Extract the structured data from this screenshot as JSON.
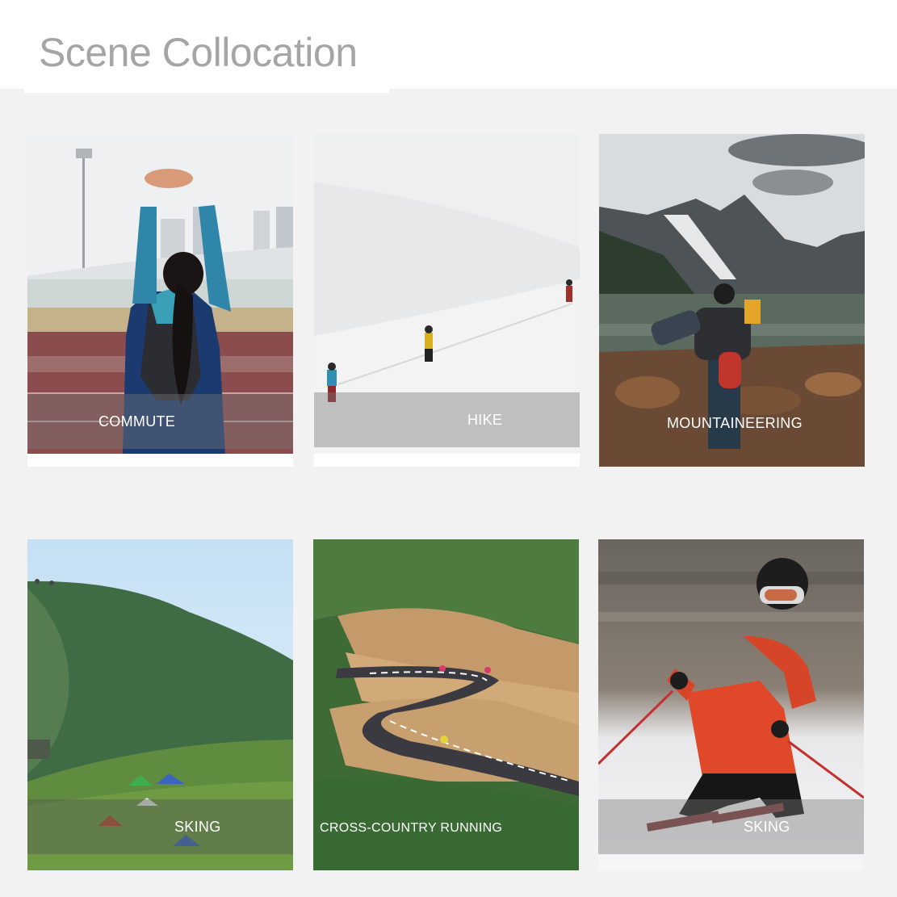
{
  "header": {
    "title": "Scene Collocation"
  },
  "cards": [
    {
      "label": "COMMUTE"
    },
    {
      "label": "HIKE"
    },
    {
      "label": "MOUNTAINEERING"
    },
    {
      "label": "SKING"
    },
    {
      "label": "CROSS-COUNTRY RUNNING"
    },
    {
      "label": "SKING"
    }
  ]
}
